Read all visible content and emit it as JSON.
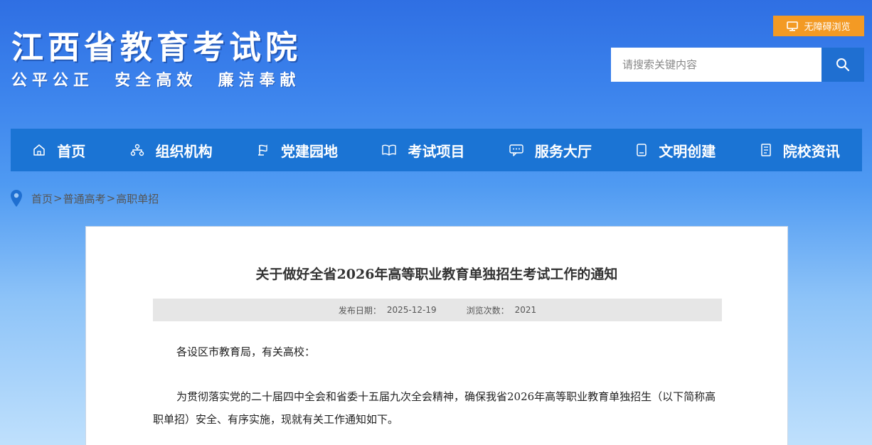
{
  "header": {
    "site_title": "江西省教育考试院",
    "slogan": "公平公正  安全高效  廉洁奉献",
    "accessibility_label": "无障碍浏览",
    "search_placeholder": "请搜索关键内容",
    "accent_color": "#f39a24"
  },
  "nav": {
    "items": [
      {
        "label": "首页",
        "icon": "home-icon"
      },
      {
        "label": "组织机构",
        "icon": "org-chart-icon"
      },
      {
        "label": "党建园地",
        "icon": "party-icon"
      },
      {
        "label": "考试项目",
        "icon": "book-icon"
      },
      {
        "label": "服务大厅",
        "icon": "service-icon"
      },
      {
        "label": "文明创建",
        "icon": "tablet-icon"
      },
      {
        "label": "院校资讯",
        "icon": "document-icon"
      }
    ],
    "bar_color": "#1b74d4"
  },
  "breadcrumb": {
    "items": [
      "首页",
      "普通高考",
      "高职单招"
    ],
    "separator": ">"
  },
  "article": {
    "title": "关于做好全省2026年高等职业教育单独招生考试工作的通知",
    "publish_date_label": "发布日期：",
    "publish_date": "2025-12-19",
    "views_label": "浏览次数：",
    "views": "2021",
    "salutation": "各设区市教育局，有关高校：",
    "paragraph_1": "为贯彻落实党的二十届四中全会和省委十五届九次全会精神，确保我省2026年高等职业教育单独招生（以下简称高职单招）安全、有序实施，现就有关工作通知如下。"
  }
}
